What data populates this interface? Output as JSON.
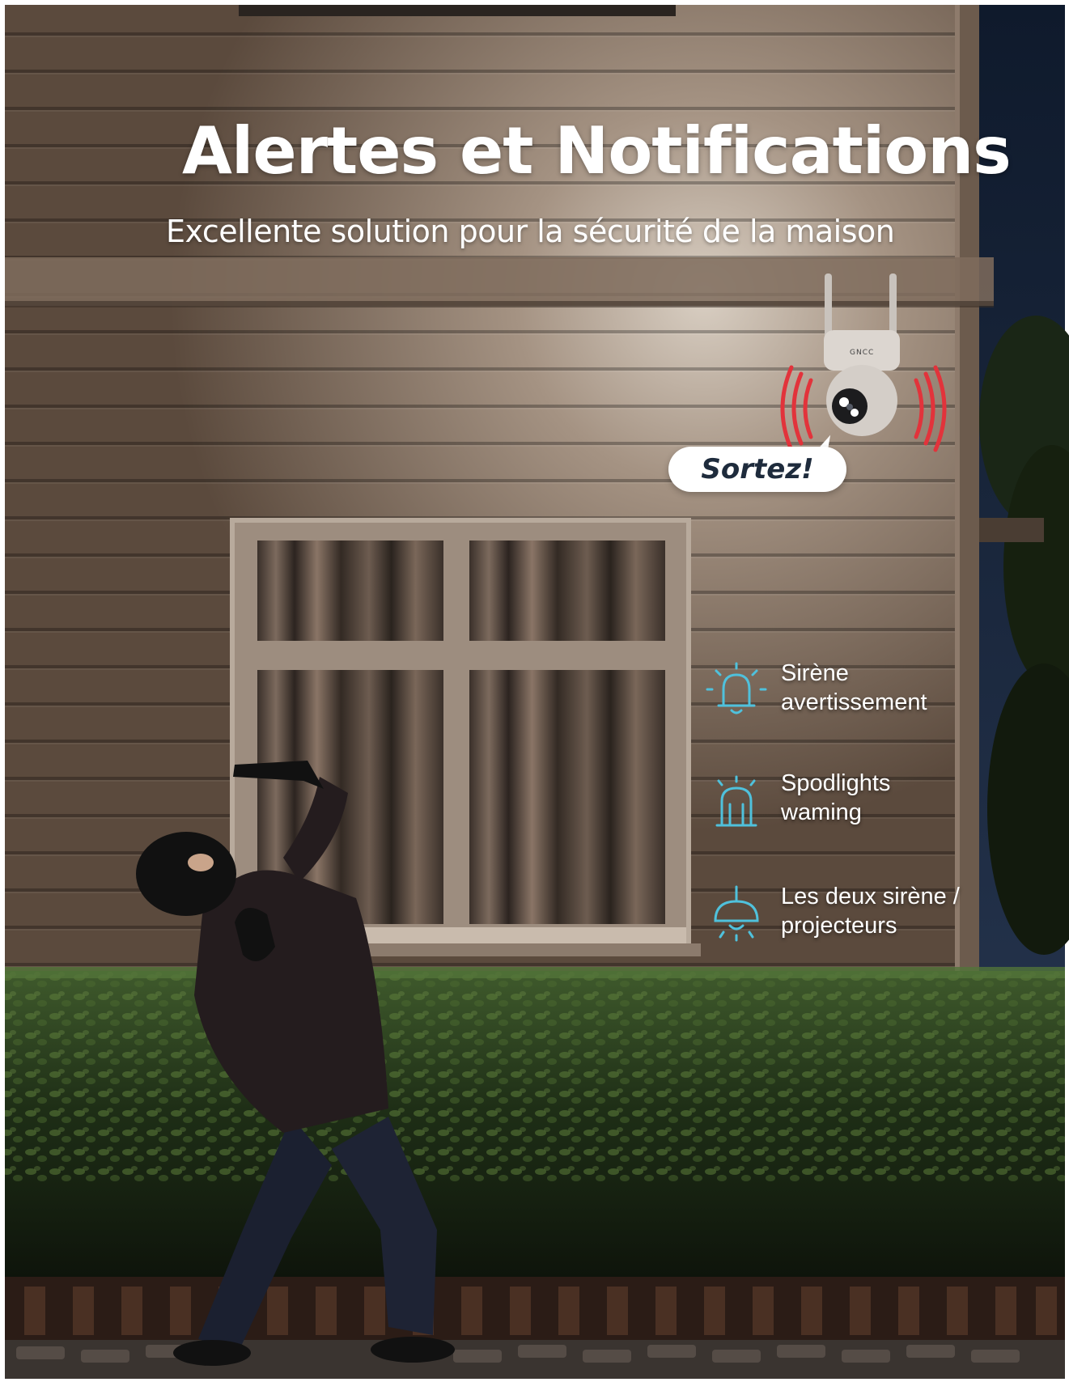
{
  "headline": {
    "title": "Alertes et Notifications",
    "subtitle": "Excellente solution pour la sécurité de la maison"
  },
  "camera": {
    "brand_label": "GNCC",
    "speech_bubble": "Sortez!"
  },
  "features": [
    {
      "icon": "siren-bell-icon",
      "line1": "Sirène",
      "line2": "avertissement"
    },
    {
      "icon": "spotlight-dome-icon",
      "line1": "Spodlights",
      "line2": "waming"
    },
    {
      "icon": "ceiling-lamp-icon",
      "line1": "Les deux sirène /",
      "line2": "projecteurs"
    }
  ],
  "colors": {
    "accent_icon": "#4fc1dc",
    "alarm_waves": "#e2333b",
    "bubble_text": "#1e2b3c"
  }
}
